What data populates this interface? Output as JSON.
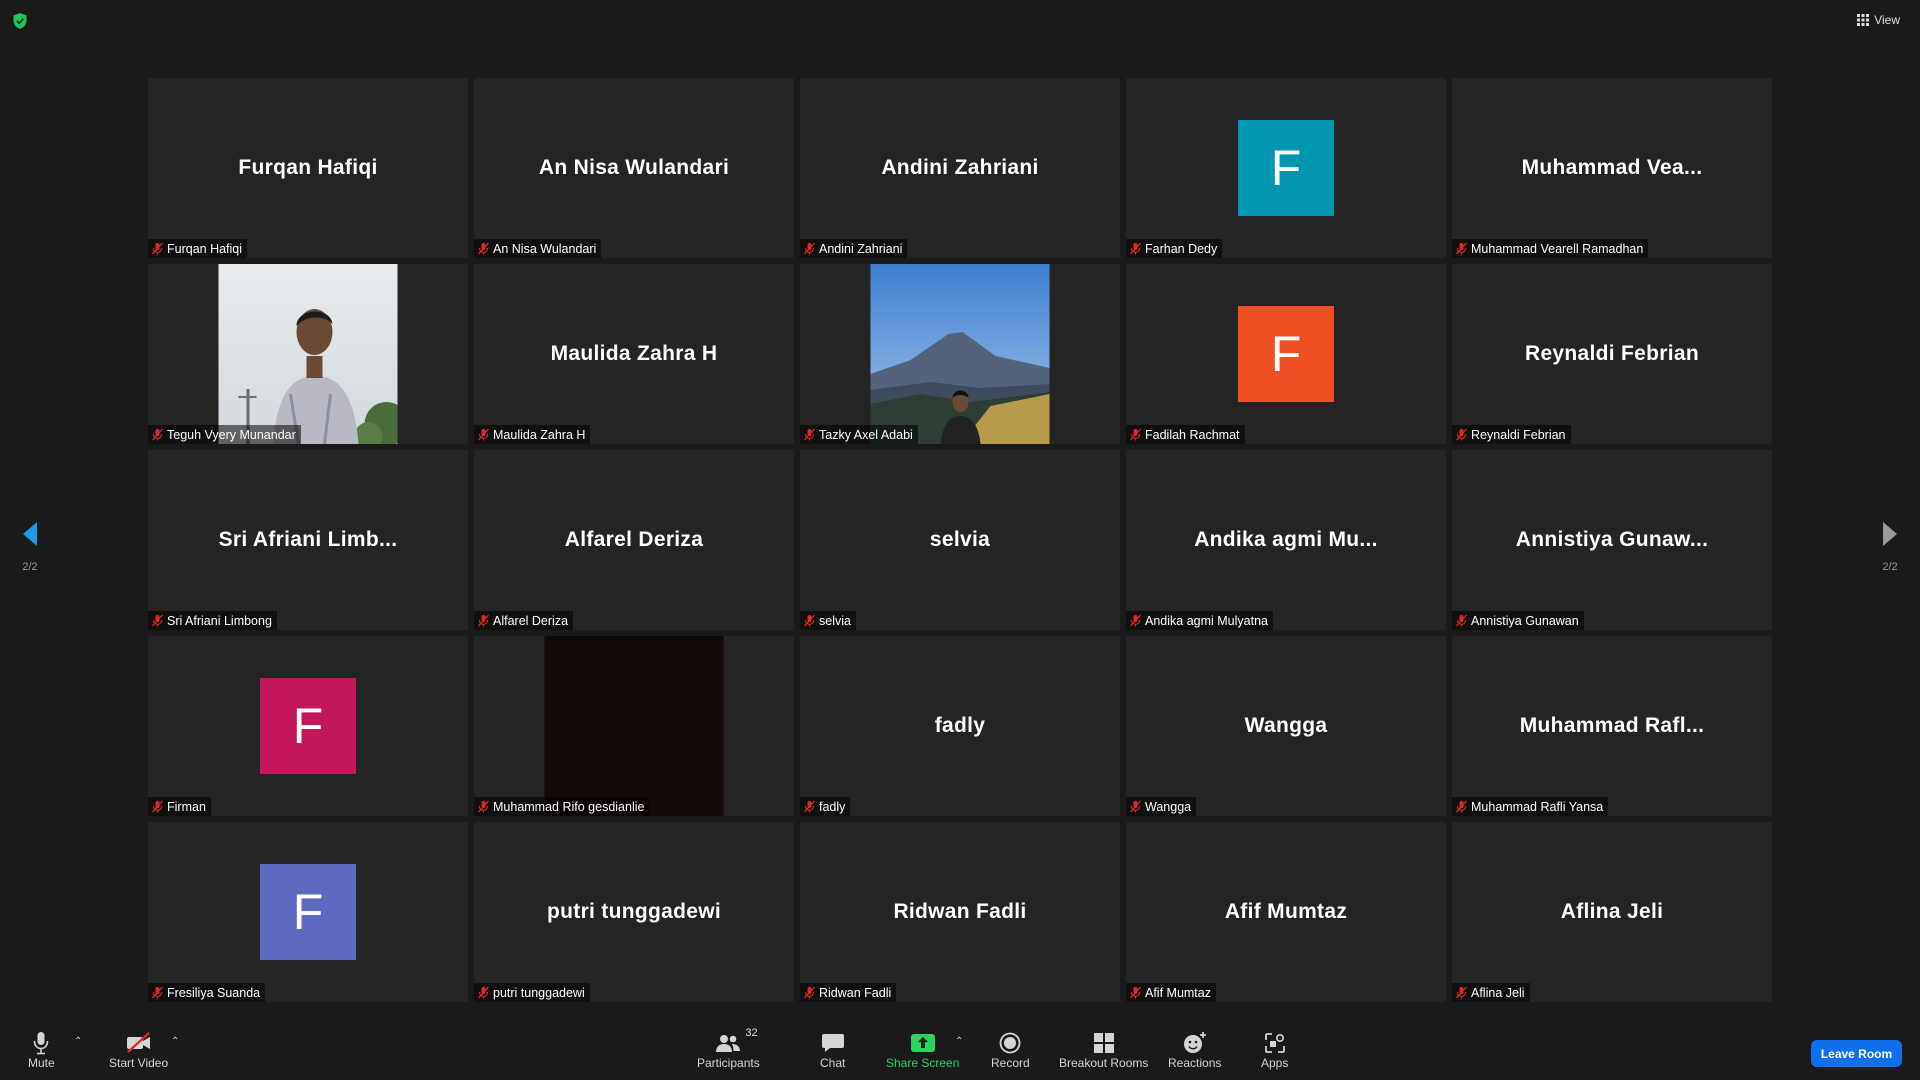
{
  "top": {
    "view_label": "View"
  },
  "nav": {
    "page_left": "2/2",
    "page_right": "2/2"
  },
  "tiles": [
    {
      "display": "Furqan Hafiqi",
      "label": "Furqan Hafiqi"
    },
    {
      "display": "An Nisa Wulandari",
      "label": "An Nisa Wulandari"
    },
    {
      "display": "Andini Zahriani",
      "label": "Andini Zahriani"
    },
    {
      "avatar": "F",
      "avatar_color": "#0096b0",
      "label": "Farhan Dedy"
    },
    {
      "display": "Muhammad  Vea...",
      "label": "Muhammad Vearell Ramadhan"
    },
    {
      "photo": "person-portrait",
      "label": "Teguh Vyery Munandar"
    },
    {
      "display": "Maulida Zahra H",
      "label": "Maulida Zahra H"
    },
    {
      "photo": "mountain-landscape",
      "label": "Tazky Axel Adabi"
    },
    {
      "avatar": "F",
      "avatar_color": "#f04e23",
      "label": "Fadilah Rachmat"
    },
    {
      "display": "Reynaldi Febrian",
      "label": "Reynaldi Febrian"
    },
    {
      "display": "Sri  Afriani  Limb...",
      "label": "Sri Afriani Limbong"
    },
    {
      "display": "Alfarel Deriza",
      "label": "Alfarel Deriza"
    },
    {
      "display": "selvia",
      "label": "selvia"
    },
    {
      "display": "Andika  agmi  Mu...",
      "label": "Andika agmi Mulyatna"
    },
    {
      "display": "Annistiya  Gunaw...",
      "label": "Annistiya Gunawan"
    },
    {
      "avatar": "F",
      "avatar_color": "#c2185b",
      "label": "Firman"
    },
    {
      "photo": "dark-video",
      "label": "Muhammad Rifo gesdianlie"
    },
    {
      "display": "fadly",
      "label": "fadly"
    },
    {
      "display": "Wangga",
      "label": "Wangga"
    },
    {
      "display": "Muhammad  Rafl...",
      "label": "Muhammad Rafli Yansa"
    },
    {
      "avatar": "F",
      "avatar_color": "#5c6bc0",
      "label": "Fresiliya Suanda"
    },
    {
      "display": "putri tunggadewi",
      "label": "putri tunggadewi"
    },
    {
      "display": "Ridwan Fadli",
      "label": "Ridwan Fadli"
    },
    {
      "display": "Afif Mumtaz",
      "label": "Afif Mumtaz"
    },
    {
      "display": "Aflina Jeli",
      "label": "Aflina Jeli"
    }
  ],
  "toolbar": {
    "mute": "Mute",
    "start_video": "Start Video",
    "participants": "Participants",
    "participants_count": "32",
    "chat": "Chat",
    "share_screen": "Share Screen",
    "record": "Record",
    "breakout_rooms": "Breakout Rooms",
    "reactions": "Reactions",
    "apps": "Apps",
    "leave": "Leave Room"
  },
  "colors": {
    "share_green": "#2bd35f",
    "leave_blue": "#0e71eb",
    "mic_off_red": "#e02828",
    "nav_arrow_blue": "#1a9be6"
  }
}
